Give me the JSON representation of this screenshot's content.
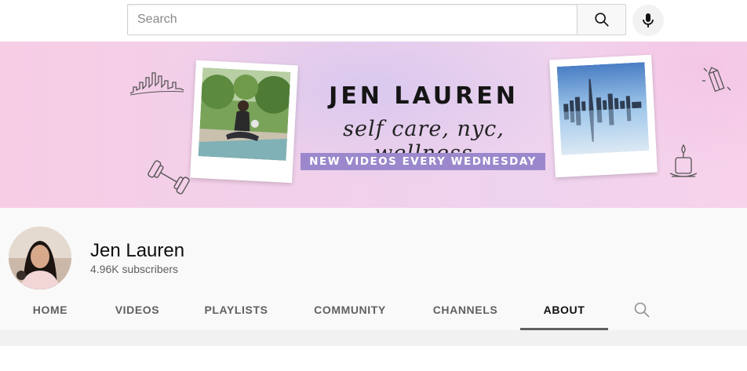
{
  "search": {
    "placeholder": "Search"
  },
  "banner": {
    "title": "JEN LAUREN",
    "tagline": "self care, nyc, wellness",
    "strip": "NEW VIDEOS EVERY WEDNESDAY"
  },
  "channel": {
    "name": "Jen Lauren",
    "subscribers": "4.96K subscribers"
  },
  "tabs": [
    {
      "label": "HOME"
    },
    {
      "label": "VIDEOS"
    },
    {
      "label": "PLAYLISTS"
    },
    {
      "label": "COMMUNITY"
    },
    {
      "label": "CHANNELS"
    },
    {
      "label": "ABOUT"
    }
  ],
  "active_tab": "ABOUT",
  "icons": {
    "search_button": "search-icon",
    "mic": "microphone-icon",
    "tab_search": "search-icon"
  },
  "colors": {
    "banner_strip": "#9b88cc",
    "active_tab_underline": "#606060",
    "tab_text": "#606060"
  }
}
